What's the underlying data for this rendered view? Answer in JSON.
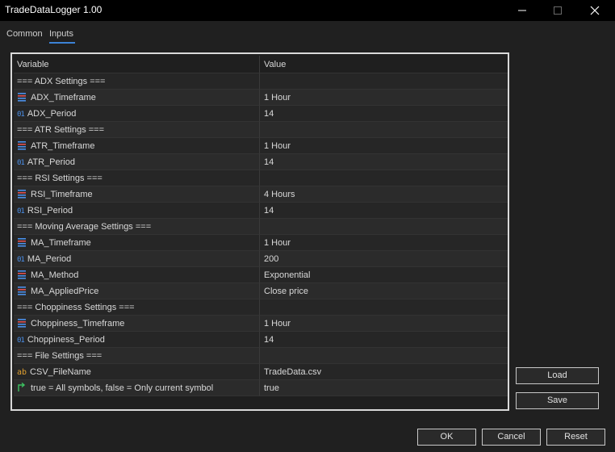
{
  "window": {
    "title": "TradeDataLogger 1.00"
  },
  "tabs": [
    {
      "label": "Common"
    },
    {
      "label": "Inputs"
    }
  ],
  "table": {
    "headers": {
      "variable": "Variable",
      "value": "Value"
    },
    "rows": [
      {
        "type": "section",
        "name": "=== ADX Settings ===",
        "value": ""
      },
      {
        "type": "enum",
        "name": "ADX_Timeframe",
        "value": "1 Hour"
      },
      {
        "type": "int",
        "name": "ADX_Period",
        "value": "14"
      },
      {
        "type": "section",
        "name": "=== ATR Settings ===",
        "value": ""
      },
      {
        "type": "enum",
        "name": "ATR_Timeframe",
        "value": "1 Hour"
      },
      {
        "type": "int",
        "name": "ATR_Period",
        "value": "14"
      },
      {
        "type": "section",
        "name": "=== RSI Settings ===",
        "value": ""
      },
      {
        "type": "enum",
        "name": "RSI_Timeframe",
        "value": "4 Hours"
      },
      {
        "type": "int",
        "name": "RSI_Period",
        "value": "14"
      },
      {
        "type": "section",
        "name": "=== Moving Average Settings ===",
        "value": ""
      },
      {
        "type": "enum",
        "name": "MA_Timeframe",
        "value": "1 Hour"
      },
      {
        "type": "int",
        "name": "MA_Period",
        "value": "200"
      },
      {
        "type": "enum",
        "name": "MA_Method",
        "value": "Exponential"
      },
      {
        "type": "enum",
        "name": "MA_AppliedPrice",
        "value": "Close price"
      },
      {
        "type": "section",
        "name": "=== Choppiness Settings ===",
        "value": ""
      },
      {
        "type": "enum",
        "name": "Choppiness_Timeframe",
        "value": "1 Hour"
      },
      {
        "type": "int",
        "name": "Choppiness_Period",
        "value": "14"
      },
      {
        "type": "section",
        "name": "=== File Settings ===",
        "value": ""
      },
      {
        "type": "string",
        "name": "CSV_FileName",
        "value": "TradeData.csv"
      },
      {
        "type": "bool",
        "name": "true = All symbols, false = Only current symbol",
        "value": "true"
      }
    ]
  },
  "side_buttons": {
    "load": "Load",
    "save": "Save"
  },
  "bottom_buttons": {
    "ok": "OK",
    "cancel": "Cancel",
    "reset": "Reset"
  },
  "icons": {
    "enum": "enum-list-icon",
    "int": "integer-01-icon",
    "string": "string-ab-icon",
    "bool": "bool-arrow-icon"
  },
  "colors": {
    "background": "#202020",
    "accent": "#3c82d6",
    "int_icon": "#4b8fe8",
    "string_icon": "#e0a030",
    "bool_icon": "#3cc060"
  }
}
